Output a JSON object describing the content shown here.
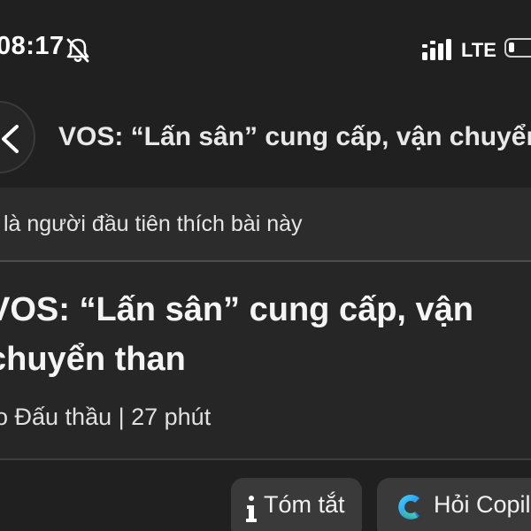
{
  "status_bar": {
    "time": "08:17",
    "network": "LTE",
    "icons": {
      "silent": "bell-slash-icon",
      "signal": "signal-bars-icon",
      "battery": "battery-icon"
    }
  },
  "header": {
    "back_icon": "chevron-left-icon",
    "title": "VOS: “Lấn sân” cung cấp, vận chuyển than"
  },
  "likes": {
    "text": "là người đầu tiên thích bài này"
  },
  "article": {
    "headline": "VOS: “Lấn sân” cung cấp, vận\nchuyển than",
    "meta": "o Đấu thầu | 27 phút"
  },
  "actions": {
    "summary": {
      "label": "Tóm tắt",
      "icon": "info-icon"
    },
    "copilot": {
      "label": "Hỏi Copilot",
      "icon": "copilot-icon"
    }
  },
  "colors": {
    "background": "#202020",
    "likes_bar": "#2c2c2c",
    "article_bg": "#262626",
    "button_bg": "#3a3a3a",
    "text": "#f2f2f2"
  }
}
